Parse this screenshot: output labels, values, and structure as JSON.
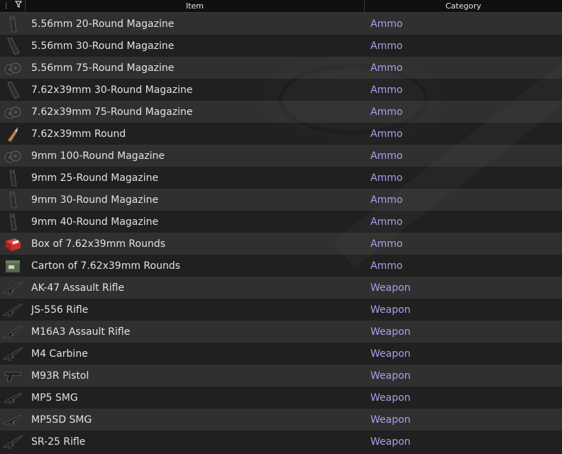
{
  "header": {
    "columns": {
      "item": "Item",
      "category": "Category"
    }
  },
  "colors": {
    "category_text": "#a8a2e8",
    "item_text": "#e2e2e2"
  },
  "rows": [
    {
      "name": "5.56mm 20-Round Magazine",
      "category": "Ammo",
      "icon": "magazine-straight-icon"
    },
    {
      "name": "5.56mm 30-Round Magazine",
      "category": "Ammo",
      "icon": "magazine-curved-icon"
    },
    {
      "name": "5.56mm 75-Round Magazine",
      "category": "Ammo",
      "icon": "drum-magazine-icon"
    },
    {
      "name": "7.62x39mm 30-Round Magazine",
      "category": "Ammo",
      "icon": "magazine-curved-icon"
    },
    {
      "name": "7.62x39mm 75-Round Magazine",
      "category": "Ammo",
      "icon": "drum-magazine-icon"
    },
    {
      "name": "7.62x39mm Round",
      "category": "Ammo",
      "icon": "bullet-icon"
    },
    {
      "name": "9mm 100-Round Magazine",
      "category": "Ammo",
      "icon": "drum-magazine-icon"
    },
    {
      "name": "9mm 25-Round Magazine",
      "category": "Ammo",
      "icon": "magazine-straight-icon"
    },
    {
      "name": "9mm 30-Round Magazine",
      "category": "Ammo",
      "icon": "magazine-straight-icon"
    },
    {
      "name": "9mm 40-Round Magazine",
      "category": "Ammo",
      "icon": "magazine-straight-icon"
    },
    {
      "name": "Box of 7.62x39mm Rounds",
      "category": "Ammo",
      "icon": "ammo-box-icon"
    },
    {
      "name": "Carton of 7.62x39mm Rounds",
      "category": "Ammo",
      "icon": "ammo-carton-icon"
    },
    {
      "name": "AK-47 Assault Rifle",
      "category": "Weapon",
      "icon": "rifle-icon"
    },
    {
      "name": "JS-556 Rifle",
      "category": "Weapon",
      "icon": "rifle-icon"
    },
    {
      "name": "M16A3 Assault Rifle",
      "category": "Weapon",
      "icon": "rifle-icon"
    },
    {
      "name": "M4 Carbine",
      "category": "Weapon",
      "icon": "rifle-icon"
    },
    {
      "name": "M93R Pistol",
      "category": "Weapon",
      "icon": "pistol-icon"
    },
    {
      "name": "MP5 SMG",
      "category": "Weapon",
      "icon": "smg-icon"
    },
    {
      "name": "MP5SD SMG",
      "category": "Weapon",
      "icon": "smg-icon"
    },
    {
      "name": "SR-25 Rifle",
      "category": "Weapon",
      "icon": "rifle-icon"
    }
  ]
}
